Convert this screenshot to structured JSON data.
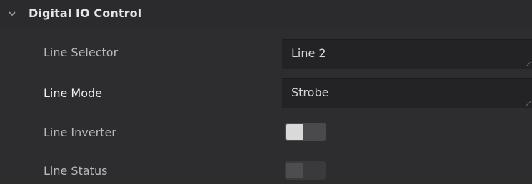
{
  "section": {
    "title": "Digital IO Control",
    "expanded": true
  },
  "rows": {
    "line_selector": {
      "label": "Line Selector",
      "value": "Line 2"
    },
    "line_mode": {
      "label": "Line Mode",
      "value": "Strobe"
    },
    "line_inverter": {
      "label": "Line Inverter",
      "state": "off"
    },
    "line_status": {
      "label": "Line Status",
      "state": "off (disabled)"
    }
  },
  "colors": {
    "background": "#2d2d2f",
    "dropdown_bg": "#232325",
    "label_text": "#b9b9bb",
    "active_label_text": "#f0f0f0",
    "toggle_knob": "#d9d9d9"
  },
  "icons": {
    "section_toggle": "chevron-down-icon",
    "dropdown_grip": "resize-grip-icon"
  }
}
